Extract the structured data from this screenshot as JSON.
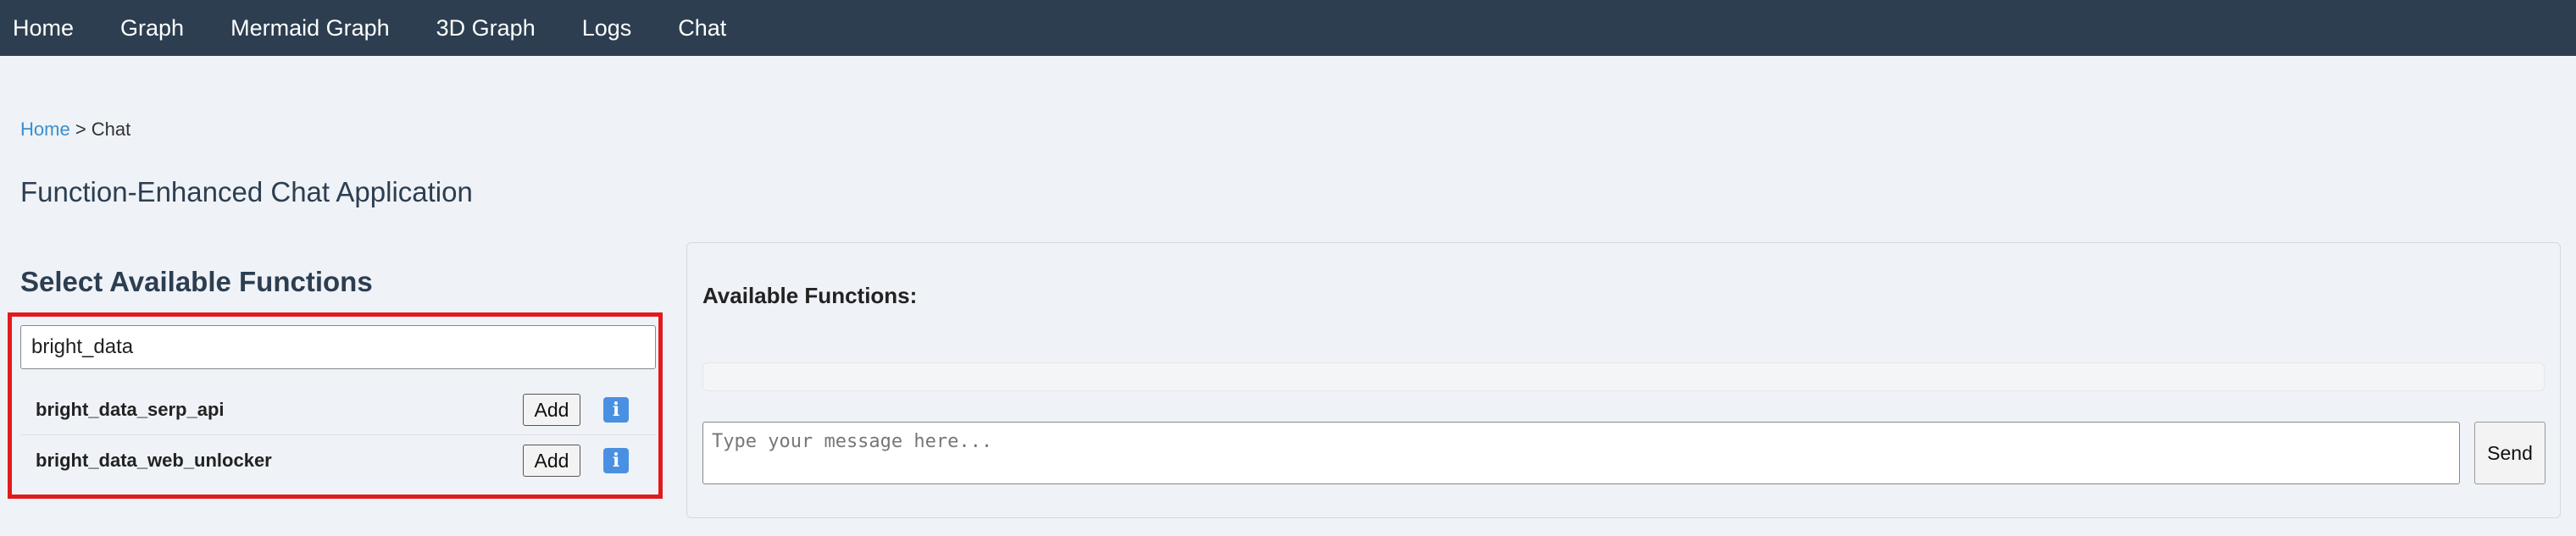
{
  "nav": {
    "items": [
      {
        "label": "Home"
      },
      {
        "label": "Graph"
      },
      {
        "label": "Mermaid Graph"
      },
      {
        "label": "3D Graph"
      },
      {
        "label": "Logs"
      },
      {
        "label": "Chat"
      }
    ]
  },
  "breadcrumb": {
    "home": "Home",
    "separator": ">",
    "current": "Chat"
  },
  "page": {
    "title": "Function-Enhanced Chat Application"
  },
  "functions_selector": {
    "title": "Select Available Functions",
    "search_value": "bright_data",
    "results": [
      {
        "name": "bright_data_serp_api",
        "add_label": "Add",
        "info_label": "i"
      },
      {
        "name": "bright_data_web_unlocker",
        "add_label": "Add",
        "info_label": "i"
      }
    ]
  },
  "chat": {
    "available_heading": "Available Functions:",
    "message_placeholder": "Type your message here...",
    "send_label": "Send"
  },
  "colors": {
    "nav_bg": "#2c3e50",
    "page_bg": "#eff2f7",
    "link": "#3a8fd0",
    "highlight_border": "#e11b1b",
    "info_icon_bg": "#4a90e2"
  }
}
